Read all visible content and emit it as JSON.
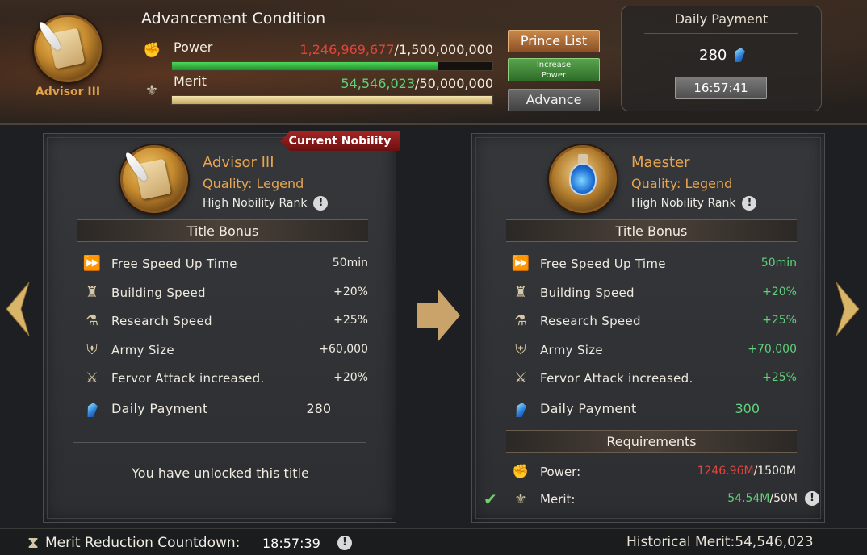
{
  "header": {
    "rank_name": "Advisor III",
    "title": "Advancement Condition",
    "power": {
      "label": "Power",
      "current": "1,246,969,677",
      "total": "/1,500,000,000",
      "progress": 0.83
    },
    "merit": {
      "label": "Merit",
      "current": "54,546,023",
      "total": "/50,000,000",
      "progress": 1.0
    },
    "buttons": {
      "prince_list": "Prince List",
      "increase_power_line1": "Increase",
      "increase_power_line2": "Power",
      "advance": "Advance"
    },
    "daily_payment": {
      "title": "Daily Payment",
      "amount": "280",
      "timer": "16:57:41"
    }
  },
  "left_panel": {
    "tag": "Current Nobility",
    "name": "Advisor III",
    "quality": "Quality: Legend",
    "rank": "High Nobility Rank",
    "section_title": "Title Bonus",
    "bonuses": [
      {
        "label": "Free Speed Up Time",
        "value": "50min",
        "icon": "free-speed-icon"
      },
      {
        "label": "Building Speed",
        "value": "+20%",
        "icon": "building-speed-icon"
      },
      {
        "label": "Research Speed",
        "value": "+25%",
        "icon": "research-speed-icon"
      },
      {
        "label": "Army Size",
        "value": "+60,000",
        "icon": "army-size-icon"
      },
      {
        "label": "Fervor Attack increased.",
        "value": "+20%",
        "icon": "crossed-swords-icon"
      }
    ],
    "daily_payment": {
      "label": "Daily Payment",
      "value": "280"
    },
    "unlock_text": "You have unlocked this title"
  },
  "right_panel": {
    "name": "Maester",
    "quality": "Quality: Legend",
    "rank": "High Nobility Rank",
    "section_title": "Title Bonus",
    "bonuses": [
      {
        "label": "Free Speed Up Time",
        "value": "50min",
        "icon": "free-speed-icon"
      },
      {
        "label": "Building Speed",
        "value": "+20%",
        "icon": "building-speed-icon"
      },
      {
        "label": "Research Speed",
        "value": "+25%",
        "icon": "research-speed-icon"
      },
      {
        "label": "Army Size",
        "value": "+70,000",
        "icon": "army-size-icon"
      },
      {
        "label": "Fervor Attack increased.",
        "value": "+25%",
        "icon": "crossed-swords-icon"
      }
    ],
    "daily_payment": {
      "label": "Daily Payment",
      "value": "300"
    },
    "requirements_title": "Requirements",
    "requirements": {
      "power": {
        "label": "Power:",
        "current": "1246.96M",
        "total": "/1500M"
      },
      "merit": {
        "label": "Merit:",
        "current": "54.54M",
        "total": "/50M"
      }
    }
  },
  "footer": {
    "countdown_label": "Merit Reduction Countdown:",
    "countdown_time": "18:57:39",
    "historical_merit": "Historical Merit:54,546,023"
  },
  "colors": {
    "accent": "#e8a54f",
    "green": "#5fd17a",
    "red": "#e0453c"
  }
}
